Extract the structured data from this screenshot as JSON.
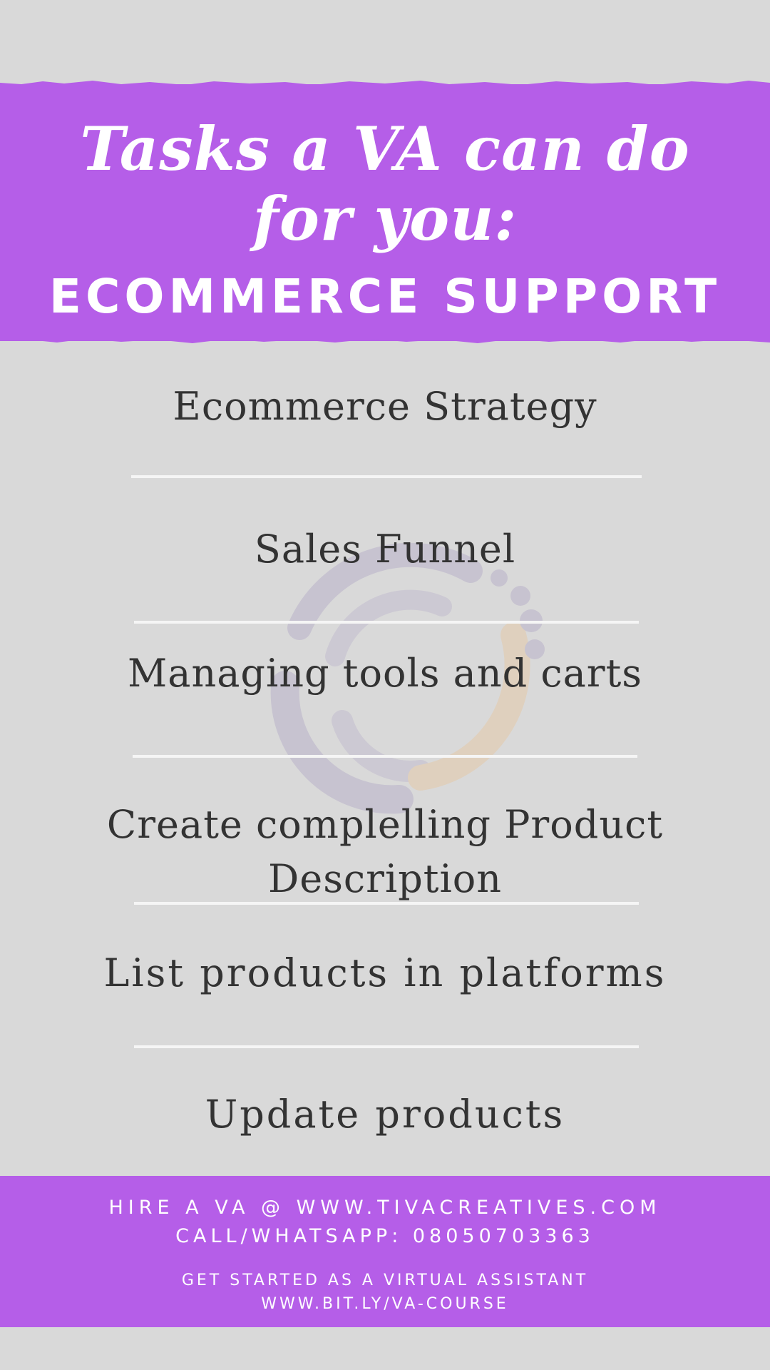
{
  "header": {
    "title_line_1": "Tasks a VA can do",
    "title_line_2": "for you:",
    "subtitle": "ECOMMERCE SUPPORT"
  },
  "tasks": [
    {
      "label": "Ecommerce Strategy"
    },
    {
      "label": "Sales Funnel"
    },
    {
      "label": "Managing tools and carts"
    },
    {
      "label_line_1": "Create complelling Product",
      "label_line_2": "Description"
    },
    {
      "label": "List products in platforms"
    },
    {
      "label": "Update products"
    }
  ],
  "footer": {
    "line_1": "HIRE A VA @ WWW.TIVACREATIVES.COM",
    "line_2": "CALL/WHATSAPP: 08050703363",
    "line_3": "GET STARTED AS A VIRTUAL ASSISTANT",
    "line_4": "WWW.BIT.LY/VA-COURSE"
  },
  "colors": {
    "background": "#d9d9d9",
    "accent_purple": "#b55ee8",
    "text_dark": "#333333",
    "text_light": "#ffffff",
    "divider": "#f5f5f5"
  },
  "icons": {
    "watermark": "circular-swirl-logo-icon"
  }
}
